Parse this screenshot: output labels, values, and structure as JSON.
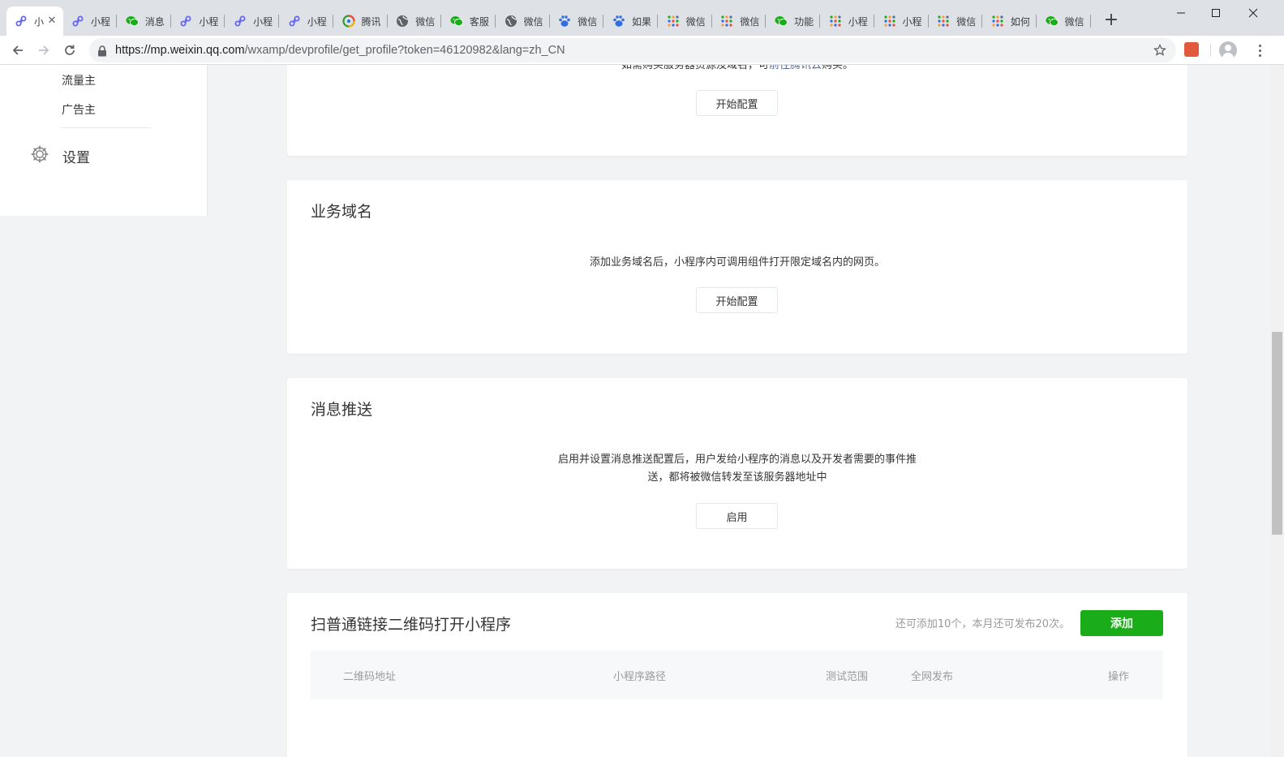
{
  "browser": {
    "tabs": [
      {
        "title": "小",
        "icon": "mp-link-icon",
        "active": true
      },
      {
        "title": "小程",
        "icon": "mp-link-icon"
      },
      {
        "title": "消息",
        "icon": "wechat-icon"
      },
      {
        "title": "小程",
        "icon": "mp-link-icon"
      },
      {
        "title": "小程",
        "icon": "mp-link-icon"
      },
      {
        "title": "小程",
        "icon": "mp-link-icon"
      },
      {
        "title": "腾讯",
        "icon": "tencent-icon"
      },
      {
        "title": "微信",
        "icon": "globe-icon"
      },
      {
        "title": "客服",
        "icon": "wechat-icon"
      },
      {
        "title": "微信",
        "icon": "globe-icon"
      },
      {
        "title": "微信",
        "icon": "baidu-icon"
      },
      {
        "title": "如果",
        "icon": "baidu-icon"
      },
      {
        "title": "微信",
        "icon": "dots-grid-icon"
      },
      {
        "title": "微信",
        "icon": "dots-grid-icon"
      },
      {
        "title": "功能",
        "icon": "wechat-icon"
      },
      {
        "title": "小程",
        "icon": "dots-grid-icon"
      },
      {
        "title": "小程",
        "icon": "dots-grid-icon"
      },
      {
        "title": "微信",
        "icon": "dots-grid-icon"
      },
      {
        "title": "如何",
        "icon": "dots-grid-icon"
      },
      {
        "title": "微信",
        "icon": "wechat-icon"
      }
    ],
    "new_tab": "+",
    "url_host": "https://mp.weixin.qq.com",
    "url_path": "/wxamp/devprofile/get_profile?token=46120982&lang=zh_CN"
  },
  "sidebar": {
    "items": [
      {
        "label": "流量主"
      },
      {
        "label": "广告主"
      }
    ],
    "settings_label": "设置"
  },
  "sections": {
    "server_domain": {
      "desc_prefix": "如需购买服务器资源及域名，可",
      "desc_link": "前往腾讯云",
      "desc_suffix": "购买。",
      "button": "开始配置"
    },
    "business_domain": {
      "title": "业务域名",
      "desc": "添加业务域名后，小程序内可调用组件打开限定域名内的网页。",
      "button": "开始配置"
    },
    "message_push": {
      "title": "消息推送",
      "desc_line1": "启用并设置消息推送配置后，用户发给小程序的消息以及开发者需要的事件推",
      "desc_line2": "送，都将被微信转发至该服务器地址中",
      "button": "启用"
    },
    "qrcode": {
      "title": "扫普通链接二维码打开小程序",
      "quota": "还可添加10个，本月还可发布20次。",
      "add_button": "添加",
      "columns": [
        "二维码地址",
        "小程序路径",
        "测试范围",
        "全网发布",
        "操作"
      ]
    }
  },
  "colors": {
    "accent_green": "#1aad19",
    "link_blue": "#576b95"
  }
}
